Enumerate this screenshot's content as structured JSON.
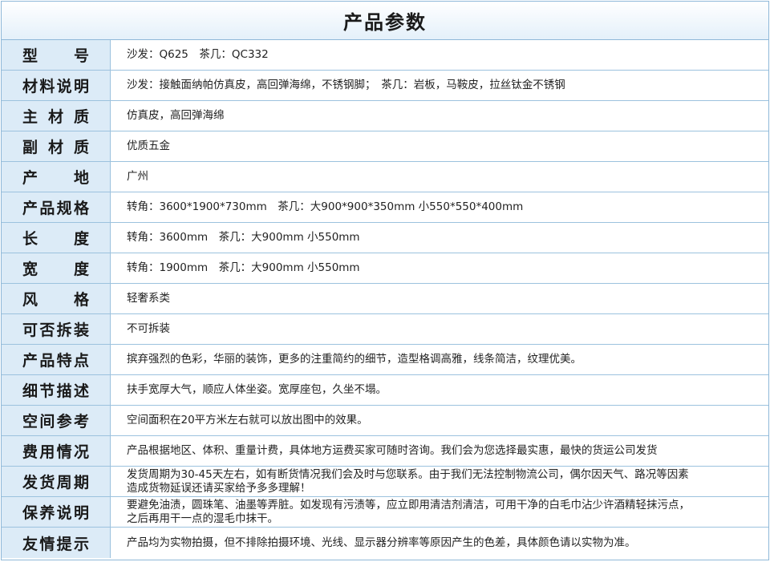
{
  "title": "产品参数",
  "rows": [
    {
      "label": "型　号",
      "value": "沙发：Q625　茶几：QC332"
    },
    {
      "label": "材料说明",
      "value": "沙发：接触面纳帕仿真皮，高回弹海绵，不锈钢脚；　茶几：岩板，马鞍皮，拉丝钛金不锈钢"
    },
    {
      "label": "主材质",
      "value": "仿真皮，高回弹海绵"
    },
    {
      "label": "副材质",
      "value": "优质五金"
    },
    {
      "label": "产　地",
      "value": "广州"
    },
    {
      "label": "产品规格",
      "value": "转角：3600*1900*730mm　茶几：大900*900*350mm 小550*550*400mm"
    },
    {
      "label": "长　度",
      "value": "转角：3600mm　茶几：大900mm 小550mm"
    },
    {
      "label": "宽　度",
      "value": "转角：1900mm　茶几：大900mm 小550mm"
    },
    {
      "label": "风　格",
      "value": "轻奢系类"
    },
    {
      "label": "可否拆装",
      "value": "不可拆装"
    },
    {
      "label": "产品特点",
      "value": "摈弃强烈的色彩，华丽的装饰，更多的注重简约的细节，造型格调高雅，线条简洁，纹理优美。"
    },
    {
      "label": "细节描述",
      "value": "扶手宽厚大气，顺应人体坐姿。宽厚座包，久坐不塌。"
    },
    {
      "label": "空间参考",
      "value": "空间面积在20平方米左右就可以放出图中的效果。"
    },
    {
      "label": "费用情况",
      "value": "产品根据地区、体积、重量计费，具体地方运费买家可随时咨询。我们会为您选择最实惠，最快的货运公司发货"
    },
    {
      "label": "发货周期",
      "value": "发货周期为30-45天左右，如有断货情况我们会及时与您联系。由于我们无法控制物流公司，偶尔因天气、路况等因素\n造成货物延误还请买家给予多多理解！"
    },
    {
      "label": "保养说明",
      "value": "要避免油渍，圆珠笔、油墨等弄脏。如发现有污渍等，应立即用清洁剂清洁，可用干净的白毛巾沾少许酒精轻抹污点，\n之后再用干一点的湿毛巾抹干。"
    },
    {
      "label": "友情提示",
      "value": "产品均为实物拍摄，但不排除拍摄环境、光线、显示器分辨率等原因产生的色差，具体颜色请以实物为准。"
    }
  ]
}
